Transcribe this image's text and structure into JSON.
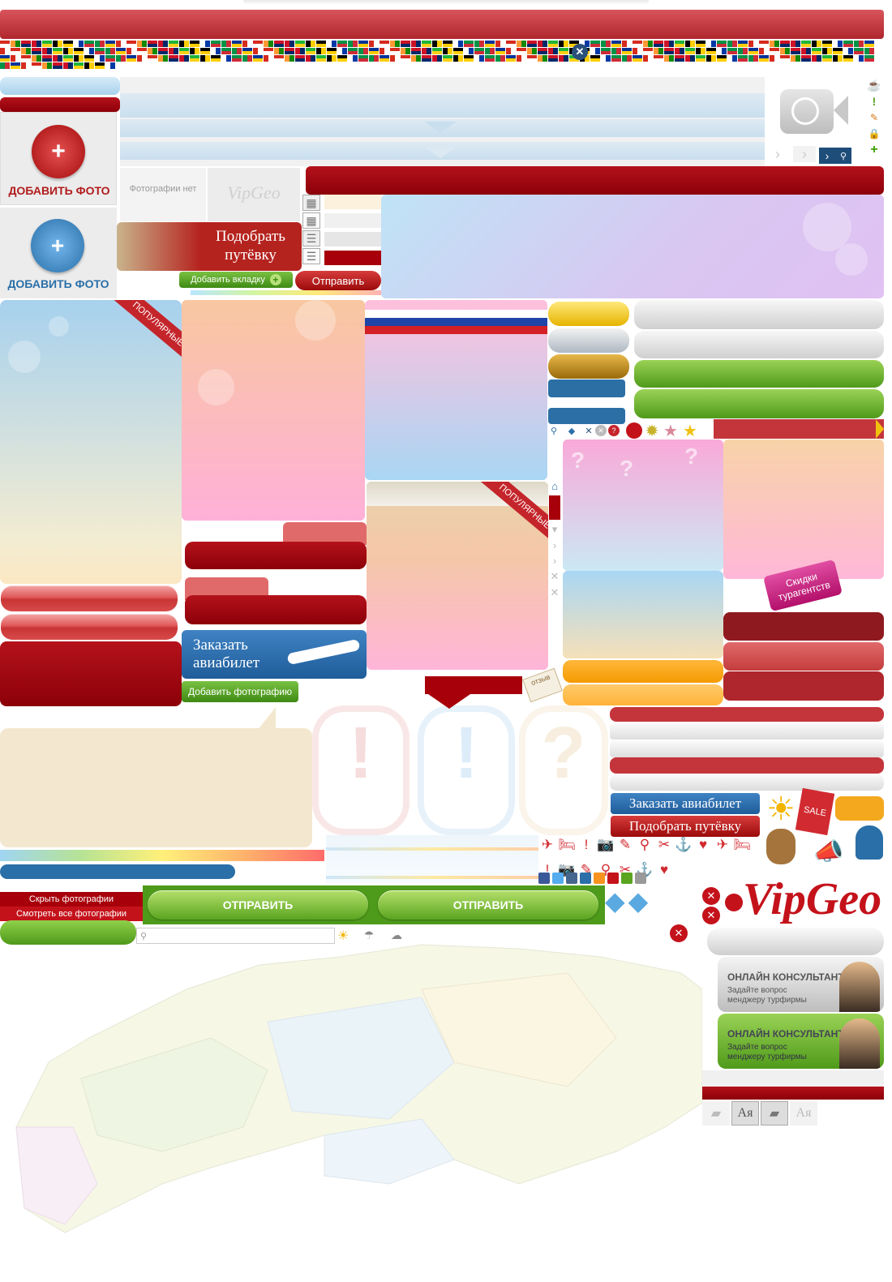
{
  "add_photo": {
    "label_red": "ДОБАВИТЬ ФОТО",
    "label_blue": "ДОБАВИТЬ ФОТО"
  },
  "no_photo": {
    "text": "Фотографии нет",
    "logo": "VipGeo"
  },
  "tour_banner": {
    "text": "Подобрать путёвку"
  },
  "buttons": {
    "add_tab": "Добавить вкладку",
    "send_red": "Отправить",
    "add_photo_green": "Добавить фотографию",
    "order_ticket": "Заказать авиабилет",
    "order_ticket_small": "Заказать авиабилет",
    "pick_tour_small": "Подобрать путёвку",
    "hide_photos": "Скрыть фотографии",
    "show_all_photos": "Смотреть все фотографии",
    "submit_1": "ОТПРАВИТЬ",
    "submit_2": "ОТПРАВИТЬ"
  },
  "ribbons": {
    "popular_1": "ПОПУЛЯРНЫЕ",
    "popular_2": "ПОПУЛЯРНЫЕ"
  },
  "tag": {
    "text": "Скидки турагентств"
  },
  "review_tag": "отзыв",
  "logo": "VipGeo",
  "sale_tag": "SALE",
  "consultant": {
    "title_1": "ОНЛАЙН КОНСУЛЬТАНТ",
    "sub_1a": "Задайте вопрос",
    "sub_1b": "менджеру турфирмы",
    "title_2": "ОНЛАЙН КОНСУЛЬТАНТ",
    "sub_2a": "Задайте вопрос",
    "sub_2b": "менджеру турфирмы"
  },
  "font_toggle": {
    "label_1": "Ая",
    "label_2": "Ая"
  },
  "search": {
    "placeholder": ""
  },
  "icons": [
    "close-icon",
    "clock-camera-icon",
    "grid-view-icon",
    "list-view-icon",
    "search-icon",
    "next-arrow-icon",
    "star-icon",
    "sun-icon",
    "pencil-icon",
    "plus-icon",
    "warning-icon",
    "map-pin-icon",
    "question-icon",
    "exclamation-icon"
  ],
  "colors": {
    "brand_red": "#a8000b",
    "accent_blue": "#2a6fa8",
    "accent_green": "#5aa420",
    "cream": "#f3e7cf"
  }
}
